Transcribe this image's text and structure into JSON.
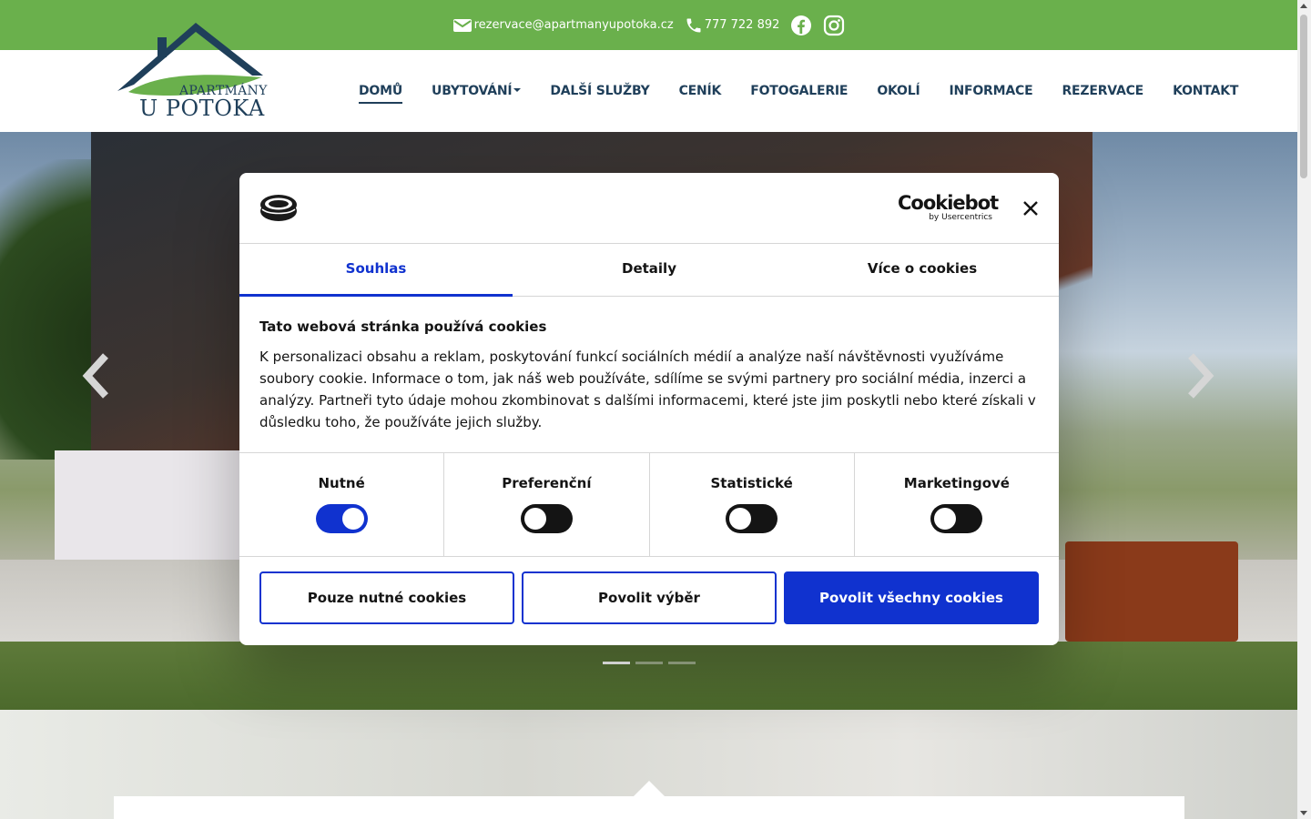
{
  "topbar": {
    "email": "rezervace@apartmanyupotoka.cz",
    "phone": "777 722 892",
    "icons": [
      "mail-icon",
      "phone-icon",
      "facebook-icon",
      "instagram-icon"
    ],
    "background": "#6ab04c"
  },
  "logo": {
    "line1": "APARTMÁNY",
    "line2": "U POTOKA"
  },
  "nav": {
    "items": [
      {
        "label": "DOMŮ",
        "active": true
      },
      {
        "label": "UBYTOVÁNÍ",
        "dropdown": true
      },
      {
        "label": "DALŠÍ SLUŽBY"
      },
      {
        "label": "CENÍK"
      },
      {
        "label": "FOTOGALERIE"
      },
      {
        "label": "OKOLÍ"
      },
      {
        "label": "INFORMACE"
      },
      {
        "label": "REZERVACE"
      },
      {
        "label": "KONTAKT"
      }
    ],
    "color": "#1f3f5a"
  },
  "carousel": {
    "prev_icon": "chevron-left-icon",
    "next_icon": "chevron-right-icon",
    "slides": 3,
    "active_slide": 1
  },
  "cookie_dialog": {
    "brand": "Cookiebot",
    "brand_sub": "by Usercentrics",
    "tabs": [
      {
        "label": "Souhlas",
        "active": true
      },
      {
        "label": "Detaily"
      },
      {
        "label": "Více o cookies"
      }
    ],
    "heading": "Tato webová stránka používá cookies",
    "text": "K personalizaci obsahu a reklam, poskytování funkcí sociálních médií a analýze naší návštěvnosti využíváme soubory cookie. Informace o tom, jak náš web používáte, sdílíme se svými partnery pro sociální média, inzerci a analýzy. Partneři tyto údaje mohou zkombinovat s dalšími informacemi, které jste jim poskytli nebo které získali v důsledku toho, že používáte jejich služby.",
    "categories": [
      {
        "label": "Nutné",
        "on": true
      },
      {
        "label": "Preferenční",
        "on": false
      },
      {
        "label": "Statistické",
        "on": false
      },
      {
        "label": "Marketingové",
        "on": false
      }
    ],
    "buttons": {
      "necessary": "Pouze nutné cookies",
      "selection": "Povolit výběr",
      "all": "Povolit všechny cookies"
    },
    "accent": "#1032cf"
  }
}
